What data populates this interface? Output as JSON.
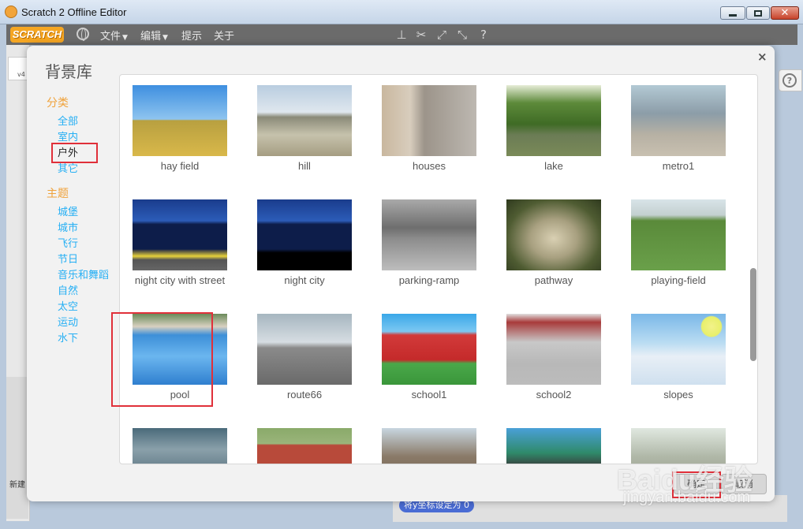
{
  "window": {
    "title": "Scratch 2 Offline Editor"
  },
  "menubar": {
    "logo": "SCRATCH",
    "items": [
      {
        "label": "文件",
        "has_caret": true
      },
      {
        "label": "编辑",
        "has_caret": true
      },
      {
        "label": "提示",
        "has_caret": false
      },
      {
        "label": "关于",
        "has_caret": false
      }
    ],
    "tools": [
      "duplicate-stamp-icon",
      "cut-scissors-icon",
      "grow-icon",
      "shrink-icon",
      "help-icon"
    ]
  },
  "background": {
    "left_version": "v4",
    "new_sprite_label": "新建",
    "block_text": "将y坐标设定为 0"
  },
  "dialog": {
    "title": "背景库",
    "close": "×",
    "sidebar": {
      "category_head": "分类",
      "categories": [
        "全部",
        "室内",
        "户外",
        "其它"
      ],
      "selected_category": "户外",
      "theme_head": "主题",
      "themes": [
        "城堡",
        "城市",
        "飞行",
        "节日",
        "音乐和舞蹈",
        "自然",
        "太空",
        "运动",
        "水下"
      ]
    },
    "items": [
      {
        "label": "hay field"
      },
      {
        "label": "hill"
      },
      {
        "label": "houses"
      },
      {
        "label": "lake"
      },
      {
        "label": "metro1"
      },
      {
        "label": "night city with street"
      },
      {
        "label": "night city"
      },
      {
        "label": "parking-ramp"
      },
      {
        "label": "pathway"
      },
      {
        "label": "playing-field"
      },
      {
        "label": "pool"
      },
      {
        "label": "route66"
      },
      {
        "label": "school1"
      },
      {
        "label": "school2"
      },
      {
        "label": "slopes"
      },
      {
        "label": ""
      },
      {
        "label": ""
      },
      {
        "label": ""
      },
      {
        "label": ""
      },
      {
        "label": ""
      }
    ],
    "highlighted_item": "pool",
    "ok_button": "确定",
    "cancel_button": "取消"
  },
  "colors": {
    "accent_orange": "#f0a23a",
    "link_blue": "#25aff4",
    "highlight_red": "#e0303a"
  },
  "watermark": {
    "text": "Baidu经验",
    "url": "jingyan.baidu.com"
  }
}
